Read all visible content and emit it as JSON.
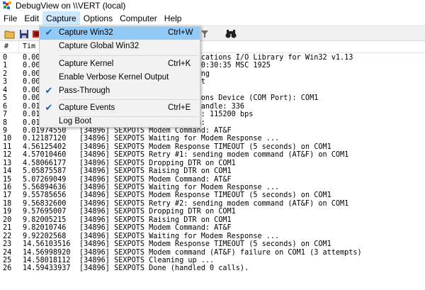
{
  "window": {
    "title": "DebugView on \\\\VERT (local)"
  },
  "menubar": {
    "items": [
      "File",
      "Edit",
      "Capture",
      "Options",
      "Computer",
      "Help"
    ],
    "active": "Capture"
  },
  "toolbar": {
    "icons": [
      "open-icon",
      "save-icon",
      "capture-icon",
      "filter-icon",
      "find-icon"
    ]
  },
  "columns": {
    "num": "#",
    "time": "Tim"
  },
  "capture_menu": {
    "items": [
      {
        "label": "Capture Win32",
        "shortcut": "Ctrl+W",
        "checked": true
      },
      {
        "label": "Capture Global Win32",
        "shortcut": "",
        "checked": false
      },
      {
        "label": "Capture Kernel",
        "shortcut": "Ctrl+K",
        "checked": false
      },
      {
        "label": "Enable Verbose Kernel Output",
        "shortcut": "",
        "checked": false
      },
      {
        "label": "Pass-Through",
        "shortcut": "",
        "checked": true
      },
      {
        "label": "Capture Events",
        "shortcut": "Ctrl+E",
        "checked": true
      },
      {
        "label": "Log Boot",
        "shortcut": "",
        "checked": false
      }
    ]
  },
  "log": [
    {
      "num": "0",
      "time": "0.00",
      "msg": "                     Communications I/O Library for Win32 v1.13"
    },
    {
      "num": "1",
      "time": "0.00",
      "msg": "                   25 2020 20:30:35 MSC 1925"
    },
    {
      "num": "2",
      "time": "0.00",
      "msg": "                     0 Running"
    },
    {
      "num": "3",
      "time": "0.00",
      "msg": "                     ocalhost"
    },
    {
      "num": "4",
      "time": "0.00",
      "msg": "                     23"
    },
    {
      "num": "5",
      "time": "0.00",
      "msg": "                     unications Device (COM Port): COM1"
    },
    {
      "num": "6",
      "time": "0.01",
      "msg": "                     evice handle: 336"
    },
    {
      "num": "7",
      "time": "0.01",
      "msg": "                     TE rate: 115200 bps"
    },
    {
      "num": "8",
      "time": "0.01",
      "msg": "                     g modem:"
    },
    {
      "num": "9",
      "time": "0.01974550",
      "msg": "[34896] SEXPOTS Modem Command: AT&F"
    },
    {
      "num": "10",
      "time": "0.12187120",
      "msg": "[34896] SEXPOTS Waiting for Modem Response ..."
    },
    {
      "num": "11",
      "time": "4.56125402",
      "msg": "[34896] SEXPOTS Modem Response TIMEOUT (5 seconds) on COM1"
    },
    {
      "num": "12",
      "time": "4.57010460",
      "msg": "[34896] SEXPOTS Retry #1: sending modem command (AT&F) on COM1"
    },
    {
      "num": "13",
      "time": "4.58066177",
      "msg": "[34896] SEXPOTS Dropping DTR on COM1"
    },
    {
      "num": "14",
      "time": "5.05875587",
      "msg": "[34896] SEXPOTS Raising DTR on COM1"
    },
    {
      "num": "15",
      "time": "5.07269049",
      "msg": "[34896] SEXPOTS Modem Command: AT&F"
    },
    {
      "num": "16",
      "time": "5.56894636",
      "msg": "[34896] SEXPOTS Waiting for Modem Response ..."
    },
    {
      "num": "17",
      "time": "9.55785656",
      "msg": "[34896] SEXPOTS Modem Response TIMEOUT (5 seconds) on COM1"
    },
    {
      "num": "18",
      "time": "9.56832600",
      "msg": "[34896] SEXPOTS Retry #2: sending modem command (AT&F) on COM1"
    },
    {
      "num": "19",
      "time": "9.57695007",
      "msg": "[34896] SEXPOTS Dropping DTR on COM1"
    },
    {
      "num": "20",
      "time": "9.82005215",
      "msg": "[34896] SEXPOTS Raising DTR on COM1"
    },
    {
      "num": "21",
      "time": "9.82010746",
      "msg": "[34896] SEXPOTS Modem Command: AT&F"
    },
    {
      "num": "22",
      "time": "9.92202568",
      "msg": "[34896] SEXPOTS Waiting for Modem Response ..."
    },
    {
      "num": "23",
      "time": "14.56103516",
      "msg": "[34896] SEXPOTS Modem Response TIMEOUT (5 seconds) on COM1"
    },
    {
      "num": "24",
      "time": "14.56998920",
      "msg": "[34896] SEXPOTS Modem command (AT&F) failure on COM1 (3 attempts)"
    },
    {
      "num": "25",
      "time": "14.58018112",
      "msg": "[34896] SEXPOTS Cleaning up ..."
    },
    {
      "num": "26",
      "time": "14.59433937",
      "msg": "[34896] SEXPOTS Done (handled 0 calls)."
    }
  ]
}
